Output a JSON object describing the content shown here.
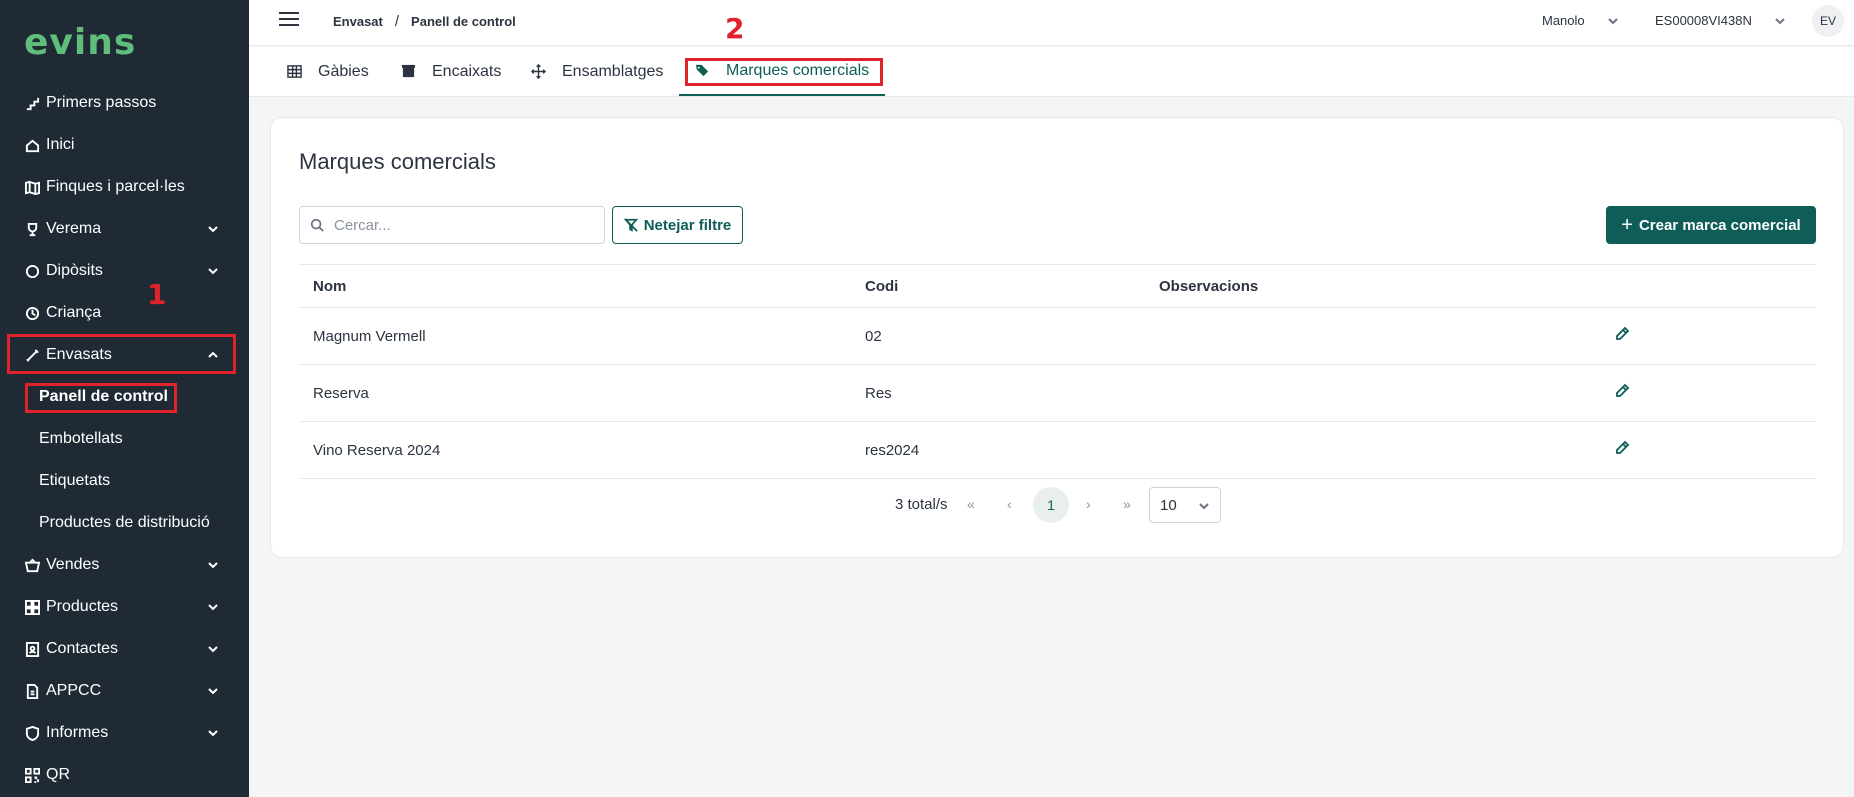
{
  "sidebar": {
    "logo": "evins",
    "items": [
      {
        "label": "Primers passos",
        "icon": "stairs-icon"
      },
      {
        "label": "Inici",
        "icon": "home-icon"
      },
      {
        "label": "Finques i parcel·les",
        "icon": "map-icon"
      },
      {
        "label": "Verema",
        "icon": "trophy-icon"
      },
      {
        "label": "Dipòsits",
        "icon": "circle-icon"
      },
      {
        "label": "Criança",
        "icon": "clock-icon"
      },
      {
        "label": "Envasats",
        "icon": "bottle-icon"
      }
    ],
    "sub_items": [
      {
        "label": "Panell de control"
      },
      {
        "label": "Embotellats"
      },
      {
        "label": "Etiquetats"
      },
      {
        "label": "Productes de distribució"
      }
    ],
    "items_after": [
      {
        "label": "Vendes",
        "icon": "basket-icon"
      },
      {
        "label": "Productes",
        "icon": "grid-icon"
      },
      {
        "label": "Contactes",
        "icon": "contact-icon"
      },
      {
        "label": "APPCC",
        "icon": "document-icon"
      },
      {
        "label": "Informes",
        "icon": "shield-icon"
      },
      {
        "label": "QR",
        "icon": "qr-icon"
      }
    ]
  },
  "annotations": {
    "first": "1",
    "second": "2"
  },
  "topbar": {
    "breadcrumb": [
      "Envasat",
      "Panell de control"
    ],
    "breadcrumb_sep": "/",
    "user": "Manolo",
    "company": "ES00008VI438N",
    "avatar": "EV"
  },
  "tabs": [
    {
      "label": "Gàbies",
      "icon": "grid-icon"
    },
    {
      "label": "Encaixats",
      "icon": "box-icon"
    },
    {
      "label": "Ensamblatges",
      "icon": "move-icon"
    },
    {
      "label": "Marques comercials",
      "icon": "tags-icon"
    }
  ],
  "main": {
    "title": "Marques comercials",
    "search_placeholder": "Cercar...",
    "clear_filter": "Netejar filtre",
    "create_button": "Crear marca comercial",
    "columns": [
      "Nom",
      "Codi",
      "Observacions"
    ],
    "rows": [
      {
        "nom": "Magnum Vermell",
        "codi": "02",
        "observacions": ""
      },
      {
        "nom": "Reserva",
        "codi": "Res",
        "observacions": ""
      },
      {
        "nom": "Vino Reserva 2024",
        "codi": "res2024",
        "observacions": ""
      }
    ],
    "pagination": {
      "total": "3 total/s",
      "first": "«",
      "prev": "‹",
      "current_page": "1",
      "next": "›",
      "last": "»",
      "page_size": "10"
    }
  },
  "colors": {
    "accent": "#0e5d57",
    "sidebar": "#1f2a35",
    "highlight": "#e0222b",
    "logo": "#5fbf7a"
  }
}
